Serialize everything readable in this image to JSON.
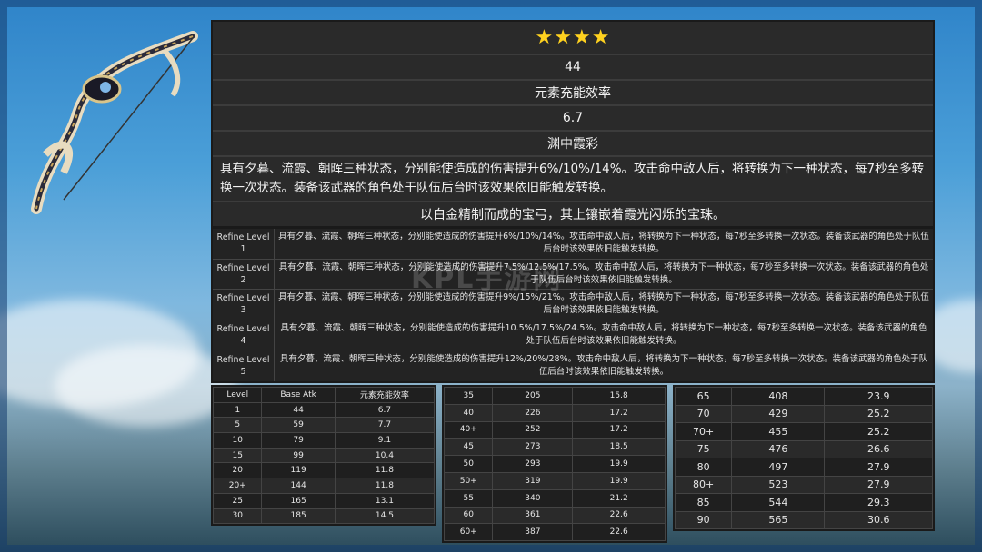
{
  "weapon": {
    "stars": "★★★★",
    "base_atk": "44",
    "substat_name": "元素充能效率",
    "substat_value": "6.7",
    "passive_name": "渊中霞彩",
    "passive_desc": "具有夕暮、流霞、朝晖三种状态，分别能使造成的伤害提升6%/10%/14%。攻击命中敌人后，将转换为下一种状态，每7秒至多转换一次状态。装备该武器的角色处于队伍后台时该效果依旧能触发转换。",
    "flavor": "以白金精制而成的宝弓，其上镶嵌着霞光闪烁的宝珠。"
  },
  "refinements": [
    {
      "label": "Refine Level 1",
      "text": "具有夕暮、流霞、朝晖三种状态，分别能使造成的伤害提升6%/10%/14%。攻击命中敌人后，将转换为下一种状态，每7秒至多转换一次状态。装备该武器的角色处于队伍后台时该效果依旧能触发转换。"
    },
    {
      "label": "Refine Level 2",
      "text": "具有夕暮、流霞、朝晖三种状态，分别能使造成的伤害提升7.5%/12.5%/17.5%。攻击命中敌人后，将转换为下一种状态，每7秒至多转换一次状态。装备该武器的角色处于队伍后台时该效果依旧能触发转换。"
    },
    {
      "label": "Refine Level 3",
      "text": "具有夕暮、流霞、朝晖三种状态，分别能使造成的伤害提升9%/15%/21%。攻击命中敌人后，将转换为下一种状态，每7秒至多转换一次状态。装备该武器的角色处于队伍后台时该效果依旧能触发转换。"
    },
    {
      "label": "Refine Level 4",
      "text": "具有夕暮、流霞、朝晖三种状态，分别能使造成的伤害提升10.5%/17.5%/24.5%。攻击命中敌人后，将转换为下一种状态，每7秒至多转换一次状态。装备该武器的角色处于队伍后台时该效果依旧能触发转换。"
    },
    {
      "label": "Refine Level 5",
      "text": "具有夕暮、流霞、朝晖三种状态，分别能使造成的伤害提升12%/20%/28%。攻击命中敌人后，将转换为下一种状态，每7秒至多转换一次状态。装备该武器的角色处于队伍后台时该效果依旧能触发转换。"
    }
  ],
  "stats_table": {
    "headers": [
      "Level",
      "Base Atk",
      "元素充能效率"
    ],
    "col1": [
      [
        "1",
        "44",
        "6.7"
      ],
      [
        "5",
        "59",
        "7.7"
      ],
      [
        "10",
        "79",
        "9.1"
      ],
      [
        "15",
        "99",
        "10.4"
      ],
      [
        "20",
        "119",
        "11.8"
      ],
      [
        "20+",
        "144",
        "11.8"
      ],
      [
        "25",
        "165",
        "13.1"
      ],
      [
        "30",
        "185",
        "14.5"
      ]
    ],
    "col2": [
      [
        "35",
        "205",
        "15.8"
      ],
      [
        "40",
        "226",
        "17.2"
      ],
      [
        "40+",
        "252",
        "17.2"
      ],
      [
        "45",
        "273",
        "18.5"
      ],
      [
        "50",
        "293",
        "19.9"
      ],
      [
        "50+",
        "319",
        "19.9"
      ],
      [
        "55",
        "340",
        "21.2"
      ],
      [
        "60",
        "361",
        "22.6"
      ],
      [
        "60+",
        "387",
        "22.6"
      ]
    ],
    "col3": [
      [
        "65",
        "408",
        "23.9"
      ],
      [
        "70",
        "429",
        "25.2"
      ],
      [
        "70+",
        "455",
        "25.2"
      ],
      [
        "75",
        "476",
        "26.6"
      ],
      [
        "80",
        "497",
        "27.9"
      ],
      [
        "80+",
        "523",
        "27.9"
      ],
      [
        "85",
        "544",
        "29.3"
      ],
      [
        "90",
        "565",
        "30.6"
      ]
    ]
  },
  "watermark": "KPL手游网"
}
